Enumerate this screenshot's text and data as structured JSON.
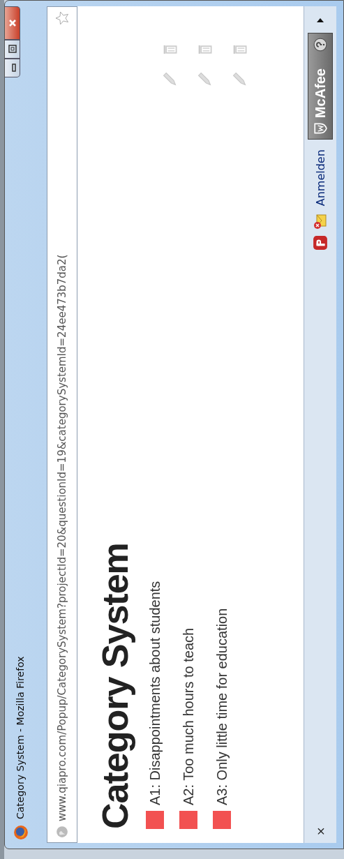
{
  "window": {
    "title": "Category System - Mozilla Firefox"
  },
  "address_bar": {
    "url": "www.qiapro.com/Popup/CategorySystem?projectId=20&questionId=19&categorySystemId=24ee473b7da2("
  },
  "heading": "Category System",
  "categories": [
    {
      "label": "A1: Disappointments about students",
      "color": "#f25151"
    },
    {
      "label": "A2: Too much hours to teach",
      "color": "#f25151"
    },
    {
      "label": "A3: Only little time for education",
      "color": "#f25151"
    }
  ],
  "status_bar": {
    "close": "×",
    "sign_in": "Anmelden",
    "security_badge": "McAfee"
  }
}
